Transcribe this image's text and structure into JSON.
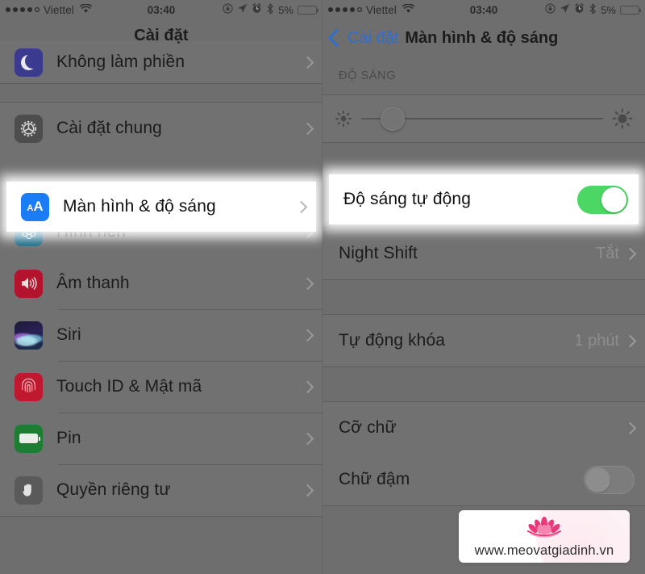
{
  "status_bar": {
    "signal_dots": [
      true,
      true,
      true,
      true,
      false
    ],
    "carrier": "Viettel",
    "wifi_icon": "wifi-icon",
    "time": "03:40",
    "icons": [
      "rotation-lock-icon",
      "location-arrow-icon",
      "alarm-clock-icon",
      "bluetooth-icon"
    ],
    "battery_percent": "5%",
    "battery_level": 5,
    "battery_color": "#e8456b"
  },
  "left_panel": {
    "nav": {
      "title": "Cài đặt"
    },
    "rows_top": [
      {
        "label": "Không làm phiền",
        "icon": "moon-icon",
        "icon_class": "ic-dnd",
        "chevron": true
      }
    ],
    "rows_mid": [
      {
        "label": "Cài đặt chung",
        "icon": "gear-icon",
        "icon_class": "ic-general",
        "chevron": true
      }
    ],
    "highlight_row": {
      "label": "Màn hình & độ sáng",
      "icon": "display-aa-icon",
      "icon_class": "ic-display",
      "chevron": true,
      "highlighted": true
    },
    "rows_bottom": [
      {
        "label": "Hình nền",
        "icon": "wallpaper-icon",
        "icon_class": "ic-wallpaper",
        "chevron": true
      },
      {
        "label": "Âm thanh",
        "icon": "speaker-icon",
        "icon_class": "ic-sound",
        "chevron": true
      },
      {
        "label": "Siri",
        "icon": "siri-icon",
        "icon_class": "ic-siri",
        "chevron": true
      },
      {
        "label": "Touch ID & Mật mã",
        "icon": "fingerprint-icon",
        "icon_class": "ic-touchid",
        "chevron": true
      },
      {
        "label": "Pin",
        "icon": "battery-icon",
        "icon_class": "ic-battery",
        "chevron": true
      },
      {
        "label": "Quyền riêng tư",
        "icon": "hand-icon",
        "icon_class": "ic-privacy",
        "chevron": true
      }
    ]
  },
  "right_panel": {
    "nav": {
      "back_label": "Cài đặt",
      "title": "Màn hình & độ sáng"
    },
    "section_header": "ĐỘ SÁNG",
    "brightness": {
      "left_icon": "brightness-low-icon",
      "right_icon": "brightness-high-icon",
      "value_percent": 13
    },
    "highlight_row": {
      "label": "Độ sáng tự động",
      "toggle_state": "on",
      "toggle_color": "#4cd764",
      "highlighted": true
    },
    "rows": [
      {
        "label": "Night Shift",
        "value": "Tắt",
        "chevron": true
      },
      {
        "label": "Tự động khóa",
        "value": "1 phút",
        "chevron": true
      },
      {
        "label": "Cỡ chữ",
        "value": "",
        "chevron": true
      },
      {
        "label": "Chữ đậm",
        "value": "",
        "chevron": false,
        "toggle_state": "off"
      }
    ]
  },
  "watermark": {
    "logo": "lotus-flower-icon",
    "url": "www.meovatgiadinh.vn",
    "accent_color": "#e8397a"
  }
}
